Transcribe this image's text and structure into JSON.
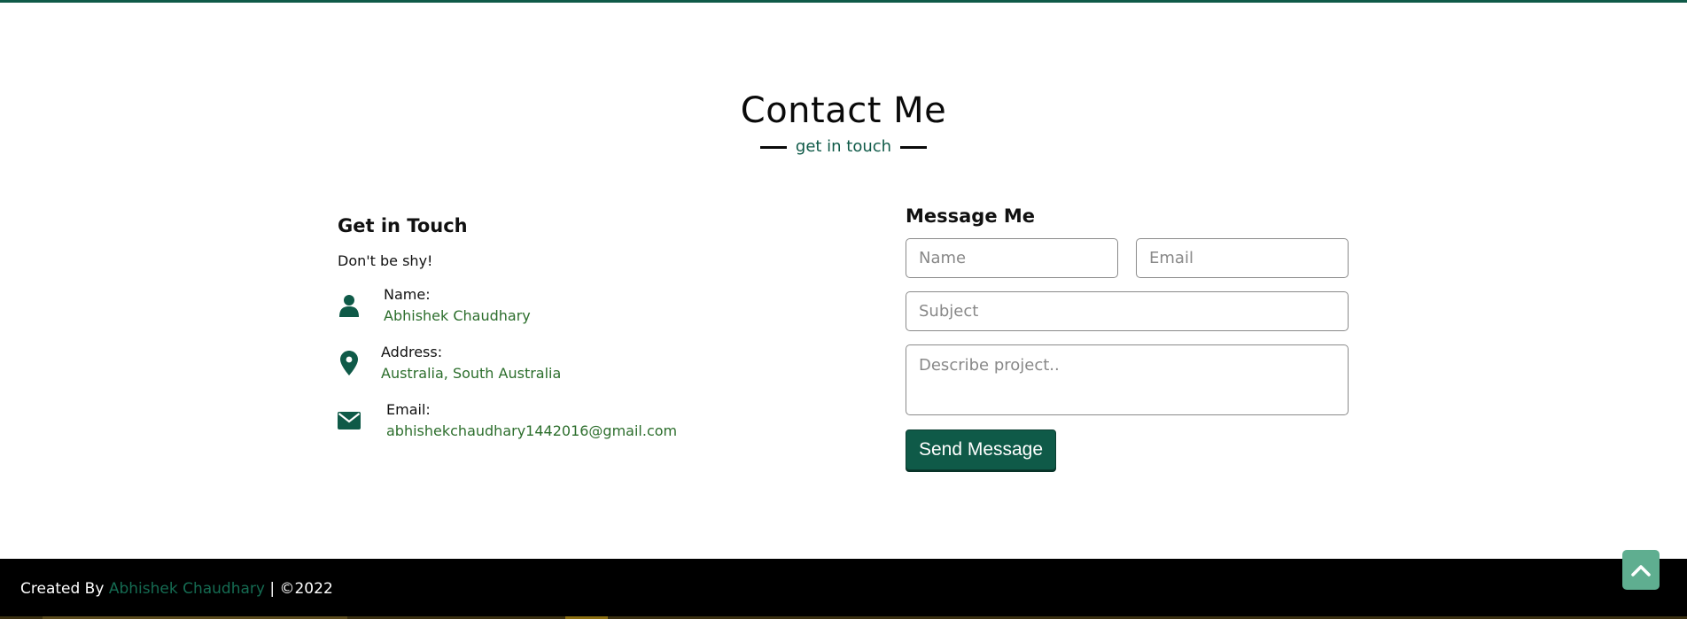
{
  "section": {
    "title": "Contact Me",
    "subtitle": "get in touch"
  },
  "contact_info": {
    "title": "Get in Touch",
    "description": "Don't be shy!",
    "items": [
      {
        "label": "Name:",
        "value": "Abhishek Chaudhary",
        "icon": "user-icon"
      },
      {
        "label": "Address:",
        "value": "Australia, South Australia",
        "icon": "map-marker-icon"
      },
      {
        "label": "Email:",
        "value": "abhishekchaudhary1442016@gmail.com",
        "icon": "envelope-icon"
      }
    ]
  },
  "form": {
    "title": "Message Me",
    "name_placeholder": "Name",
    "email_placeholder": "Email",
    "subject_placeholder": "Subject",
    "message_placeholder": "Describe project..",
    "submit_label": "Send Message"
  },
  "footer": {
    "prefix": "Created By",
    "author": "Abhishek Chaudhary",
    "suffix": "| ©2022"
  },
  "colors": {
    "accent": "#0f5a48",
    "link": "#2c6e2c",
    "scroll_button": "#5fae90",
    "footer_bg": "#000000"
  },
  "scroll_top": {
    "icon": "chevron-up-icon"
  }
}
